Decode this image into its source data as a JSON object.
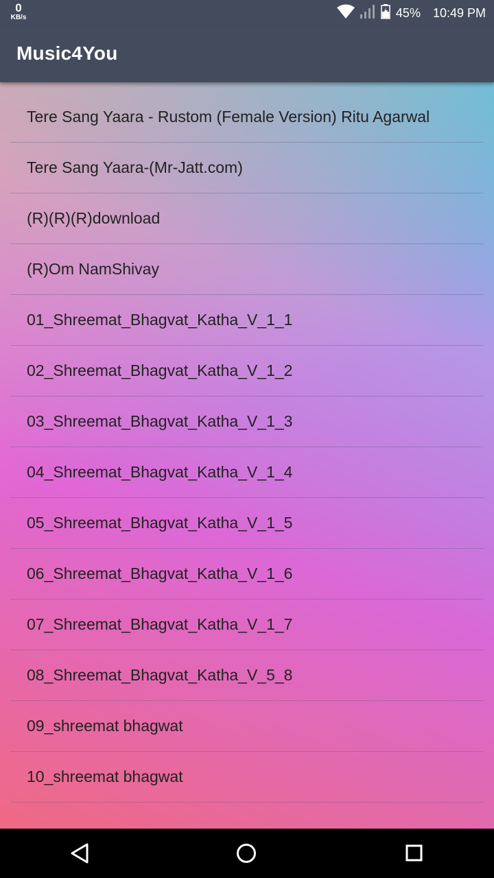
{
  "status_bar": {
    "net_speed_value": "0",
    "net_speed_unit": "KB/s",
    "battery_percent": "45%",
    "time": "10:49 PM",
    "icons": [
      "wifi-icon",
      "signal-icon",
      "battery-icon"
    ]
  },
  "app_bar": {
    "title": "Music4You",
    "color": "#444b5c"
  },
  "songs": [
    "Tere Sang Yaara - Rustom (Female Version) Ritu Agarwal",
    "Tere Sang Yaara-(Mr-Jatt.com)",
    "(R)(R)(R)download",
    "(R)Om NamShivay",
    "01_Shreemat_Bhagvat_Katha_V_1_1",
    "02_Shreemat_Bhagvat_Katha_V_1_2",
    "03_Shreemat_Bhagvat_Katha_V_1_3",
    "04_Shreemat_Bhagvat_Katha_V_1_4",
    "05_Shreemat_Bhagvat_Katha_V_1_5",
    "06_Shreemat_Bhagvat_Katha_V_1_6",
    "07_Shreemat_Bhagvat_Katha_V_1_7",
    "08_Shreemat_Bhagvat_Katha_V_5_8",
    "09_shreemat bhagwat",
    "10_shreemat bhagwat"
  ],
  "nav_bar": {
    "icons": [
      "back-icon",
      "home-icon",
      "recents-icon"
    ]
  }
}
